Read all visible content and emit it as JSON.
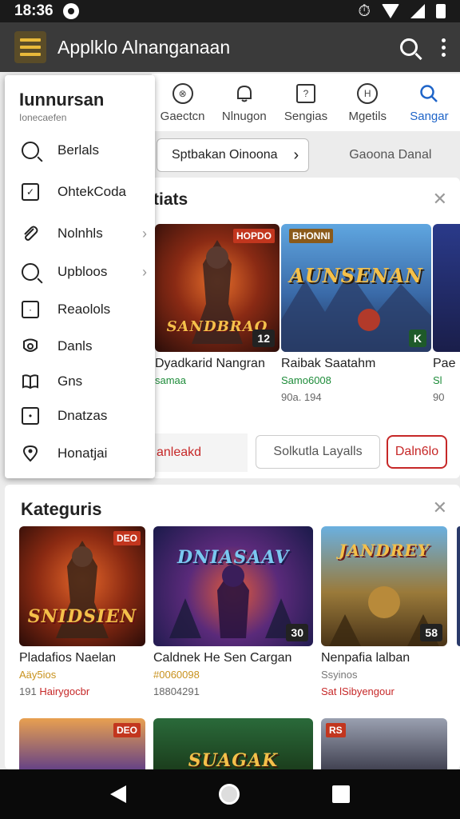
{
  "status_bar": {
    "time": "18:36"
  },
  "app_bar": {
    "title": "Applklo Alnanganaan",
    "search_icon": "search-icon",
    "more_icon": "more-vert-icon"
  },
  "tabs": [
    {
      "label": "Gaectcn",
      "icon": "⊗",
      "active": false
    },
    {
      "label": "Nlnugon",
      "icon": "⌂",
      "active": false
    },
    {
      "label": "Sengias",
      "icon": "?",
      "active": false
    },
    {
      "label": "Mgetils",
      "icon": "H",
      "active": false
    },
    {
      "label": "Sangar",
      "icon": "search",
      "active": true
    }
  ],
  "filter_row": {
    "pill_label": "Sptbakan Oinoona",
    "alt_label": "Gaoona Danal"
  },
  "featured": {
    "heading": "tiats",
    "games": [
      {
        "brand": "SANDBRAO",
        "tag": "HOPDO",
        "badge": "12",
        "name": "Dyadkarid Nangran",
        "sub": "samaa",
        "meta": ""
      },
      {
        "brand": "AUNSENAN",
        "tag": "BHONNI",
        "badge": "K",
        "name": "Raibak Saatahm",
        "sub": "Samo6008",
        "meta": "90a. 194"
      },
      {
        "brand": "",
        "tag": "",
        "badge": "",
        "name": "Pae",
        "sub": "Sl",
        "meta": "90"
      }
    ],
    "buttons": {
      "ghost": "anleakd",
      "outline": "Solkutla Layalls",
      "primary": "Daln6lo"
    }
  },
  "categories": {
    "heading": "Kateguris",
    "games": [
      {
        "brand": "SNIDSIEN",
        "tag": "DEO",
        "badge": "",
        "name": "Pladafios Naelan",
        "sub": "Aäy5ios",
        "meta_a": "191",
        "meta_b": "Hairygocbr"
      },
      {
        "brand": "DNIASAAV",
        "tag": "",
        "badge": "30",
        "name": "Caldnek He Sen Cargan",
        "sub": "#0060098",
        "meta_a": "18804291",
        "meta_b": ""
      },
      {
        "brand": "JANDREY",
        "tag": "",
        "badge": "58",
        "name": "Nenpafia lalban",
        "sub": "Ssyinos",
        "meta_a": "Sat",
        "meta_b": "lSibyengour"
      }
    ],
    "row2": [
      {
        "tag": "DEO"
      },
      {
        "brand": "SUAGAK"
      },
      {
        "tag": "RS"
      }
    ]
  },
  "drawer": {
    "title": "Iunnursan",
    "subtitle": "Ionecaefen",
    "items": [
      {
        "label": "Berlals",
        "icon": "search-icon",
        "chevron": false
      },
      {
        "label": "OhtekCoda",
        "icon": "edit-box-icon",
        "chevron": false
      },
      {
        "label": "Nolnhls",
        "icon": "paperclip-icon",
        "chevron": true
      },
      {
        "label": "Upbloos",
        "icon": "search-icon",
        "chevron": true
      },
      {
        "label": "Reaolols",
        "icon": "box-icon",
        "chevron": false
      },
      {
        "label": "Danls",
        "icon": "shield-icon",
        "chevron": false
      },
      {
        "label": "Gns",
        "icon": "book-icon",
        "chevron": false
      },
      {
        "label": "Dnatzas",
        "icon": "square-dot-icon",
        "chevron": false
      },
      {
        "label": "Honatjai",
        "icon": "location-icon",
        "chevron": false
      }
    ]
  },
  "colors": {
    "app_bar": "#3a3a3a",
    "menu_accent": "#e8b93a",
    "active_tab": "#1e64c8",
    "accent_red": "#c62828",
    "sub_green": "#1e8c3a"
  }
}
